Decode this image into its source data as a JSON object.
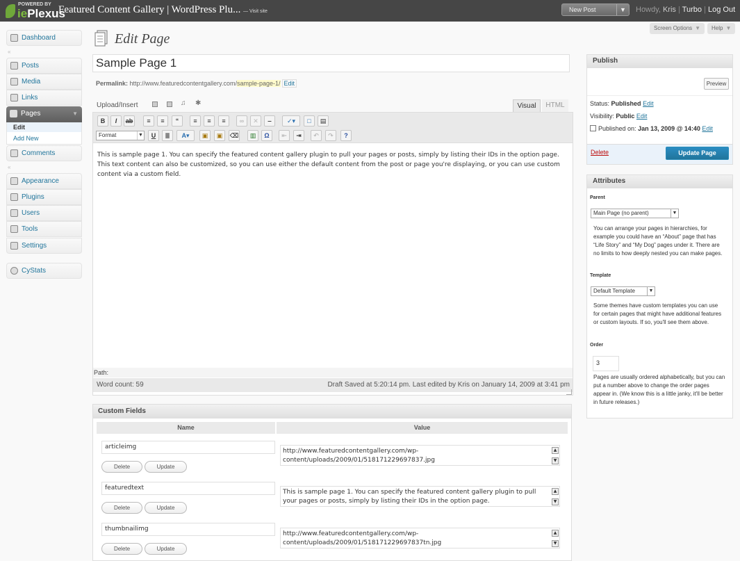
{
  "topbar": {
    "powered_by": "POWERED BY",
    "brand_ie": "ie",
    "brand_rest": "Plexus",
    "site_title": "Featured Content Gallery | WordPress Plu...",
    "visit_site": "— Visit site",
    "new_post": "New Post",
    "howdy_prefix": "Howdy,",
    "user": "Kris",
    "turbo": "Turbo",
    "logout": "Log Out"
  },
  "screen_options": "Screen Options",
  "help": "Help",
  "sidebar": {
    "dashboard": "Dashboard",
    "posts": "Posts",
    "media": "Media",
    "links": "Links",
    "pages": "Pages",
    "pages_sub": [
      "Edit",
      "Add New"
    ],
    "comments": "Comments",
    "appearance": "Appearance",
    "plugins": "Plugins",
    "users": "Users",
    "tools": "Tools",
    "settings": "Settings",
    "cystats": "CyStats"
  },
  "page": {
    "heading": "Edit Page",
    "title_value": "Sample Page 1",
    "permalink_label": "Permalink:",
    "permalink_base": "http://www.featuredcontentgallery.com/",
    "permalink_slug": "sample-page-1/",
    "permalink_edit": "Edit"
  },
  "editor": {
    "upload_insert": "Upload/Insert",
    "tab_visual": "Visual",
    "tab_html": "HTML",
    "format_select": "Format",
    "content": "This is sample page 1. You can specify the featured content gallery plugin to pull your pages or posts, simply by listing their IDs in the option page. This text content can also be customized, so you can use either the default content from the post or page you're displaying, or you can use custom content via a custom field.",
    "path_label": "Path:",
    "word_count": "Word count: 59",
    "last_edited": "Draft Saved at 5:20:14 pm. Last edited by Kris on January 14, 2009 at 3:41 pm"
  },
  "custom_fields": {
    "title": "Custom Fields",
    "col_name": "Name",
    "col_value": "Value",
    "delete_label": "Delete",
    "update_label": "Update",
    "rows": [
      {
        "key": "articleimg",
        "value": "http://www.featuredcontentgallery.com/wp-content/uploads/2009/01/518171229697837.jpg"
      },
      {
        "key": "featuredtext",
        "value": "This is sample page 1. You can specify the featured content gallery plugin to pull your pages or posts, simply by listing their IDs in the option page."
      },
      {
        "key": "thumbnailimg",
        "value": "http://www.featuredcontentgallery.com/wp-content/uploads/2009/01/518171229697837tn.jpg"
      }
    ]
  },
  "publish": {
    "title": "Publish",
    "preview": "Preview",
    "status_label": "Status:",
    "status_value": "Published",
    "visibility_label": "Visibility:",
    "visibility_value": "Public",
    "published_on_label": "Published on:",
    "published_on_value": "Jan 13, 2009 @ 14:40",
    "edit": "Edit",
    "delete": "Delete",
    "update": "Update Page"
  },
  "attributes": {
    "title": "Attributes",
    "parent_label": "Parent",
    "parent_value": "Main Page (no parent)",
    "parent_help": "You can arrange your pages in hierarchies, for example you could have an “About” page that has “Life Story” and “My Dog” pages under it. There are no limits to how deeply nested you can make pages.",
    "template_label": "Template",
    "template_value": "Default Template",
    "template_help": "Some themes have custom templates you can use for certain pages that might have additional features or custom layouts. If so, you'll see them above.",
    "order_label": "Order",
    "order_value": "3",
    "order_help": "Pages are usually ordered alphabetically, but you can put a number above to change the order pages appear in. (We know this is a little janky, it'll be better in future releases.)"
  }
}
